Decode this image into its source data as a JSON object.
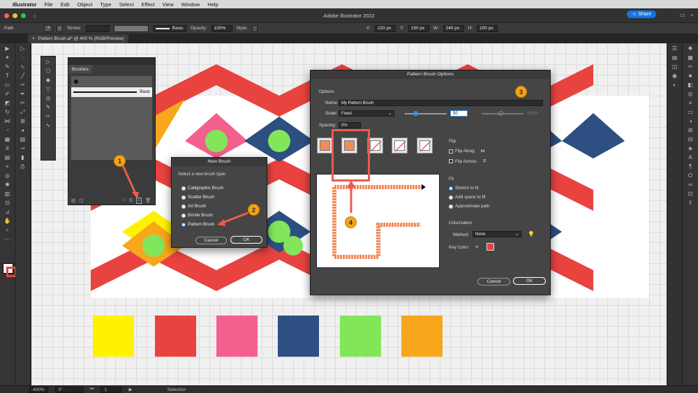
{
  "menubar": {
    "app": "Illustrator",
    "items": [
      "File",
      "Edit",
      "Object",
      "Type",
      "Select",
      "Effect",
      "View",
      "Window",
      "Help"
    ]
  },
  "window": {
    "title": "Adobe Illustrator 2022",
    "share_label": "Share"
  },
  "control_bar": {
    "selection": "Path",
    "stroke_label": "Stroke:",
    "brush_label": "Basic",
    "opacity_label": "Opacity:",
    "opacity_value": "100%",
    "style_label": "Style:",
    "x_label": "X:",
    "x_value": "220 px",
    "y_label": "Y:",
    "y_value": "150 px",
    "w_label": "W:",
    "w_value": "240 px",
    "h_label": "H:",
    "h_value": "100 px"
  },
  "document_tab": {
    "label": "Pattern Brush.ai* @ 400 % (RGB/Preview)"
  },
  "status_bar": {
    "zoom": "400%",
    "rotate": "0°",
    "artboard": "1",
    "tool": "Selection"
  },
  "brushes_panel": {
    "tab": "Brushes",
    "basic_label": "Basic"
  },
  "new_brush_dialog": {
    "title": "New Brush",
    "prompt": "Select a new brush type:",
    "options": [
      "Calligraphic Brush",
      "Scatter Brush",
      "Art Brush",
      "Bristle Brush",
      "Pattern Brush"
    ],
    "selected": "Pattern Brush",
    "cancel": "Cancel",
    "ok": "OK"
  },
  "pattern_brush_dialog": {
    "title": "Pattern Brush Options",
    "options_label": "Options",
    "name_label": "Name:",
    "name_value": "My Pattern Brush",
    "scale_label": "Scale:",
    "scale_mode": "Fixed",
    "scale_value": "50",
    "scale_max": "100%",
    "spacing_label": "Spacing:",
    "spacing_value": "0%",
    "flip_label": "Flip",
    "flip_along": "Flip Along",
    "flip_across": "Flip Across",
    "fit_label": "Fit",
    "fit_options": [
      "Stretch to fit",
      "Add space to fit",
      "Approximate path"
    ],
    "fit_selected": "Stretch to fit",
    "colorization_label": "Colorization",
    "method_label": "Method:",
    "method_value": "None",
    "key_color_label": "Key Color:",
    "key_color": "#e8433f",
    "cancel": "Cancel",
    "ok": "OK"
  },
  "callouts": [
    "1",
    "2",
    "3",
    "4"
  ],
  "swatches": [
    "#fff200",
    "#e8433f",
    "#f4608e",
    "#2d4f82",
    "#83e65a",
    "#f7a71b"
  ],
  "colors": {
    "chevron_red": "#e8433f",
    "chevron_white": "#ffffff",
    "diamond_pink": "#f4608e",
    "diamond_navy": "#2d4f82",
    "diamond_orange": "#f7a71b",
    "dot_green": "#83e65a",
    "accent_blue": "#1473e6",
    "callout": "#f4a514",
    "highlight": "#ec5b50"
  }
}
